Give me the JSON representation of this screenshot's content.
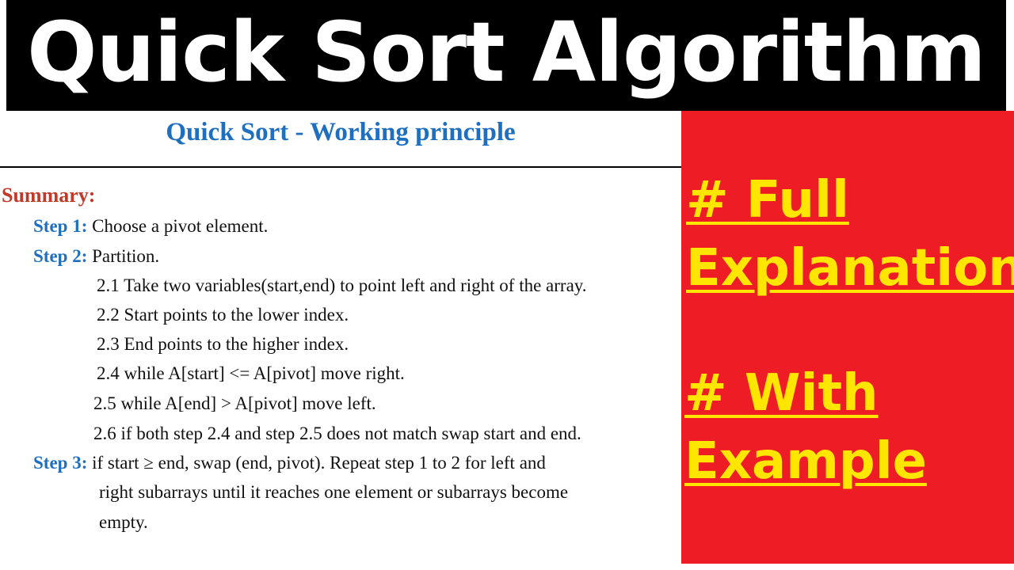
{
  "header": {
    "title": "Quick Sort Algorithm"
  },
  "content": {
    "subtitle": "Quick Sort - Working principle",
    "summary_heading": "Summary:",
    "step1": {
      "label": "Step 1:",
      "text": " Choose a pivot element."
    },
    "step2": {
      "label": "Step 2:",
      "text": " Partition.",
      "substeps": [
        "2.1 Take two variables(start,end) to point left and right of the array.",
        "2.2 Start points to the lower index.",
        "2.3 End points to the higher index.",
        "2.4 while A[start] <= A[pivot] move right.",
        "2.5 while A[end] > A[pivot] move left.",
        "2.6 if both step 2.4 and step 2.5 does not match swap start and end."
      ]
    },
    "step3": {
      "label": "Step 3:",
      "lines": [
        " if start ≥ end, swap (end, pivot). Repeat step 1 to 2 for left and",
        "right subarrays until it reaches one element or subarrays become",
        "empty."
      ]
    }
  },
  "side_panel": {
    "callouts": [
      "# Full",
      "Explanation",
      "# With",
      "Example"
    ]
  },
  "colors": {
    "banner_background": "#000000",
    "title_text": "#ffffff",
    "subtitle_blue": "#1f6fc0",
    "summary_red": "#c0392b",
    "panel_red": "#ee1c25",
    "callout_yellow": "#ffe600"
  }
}
